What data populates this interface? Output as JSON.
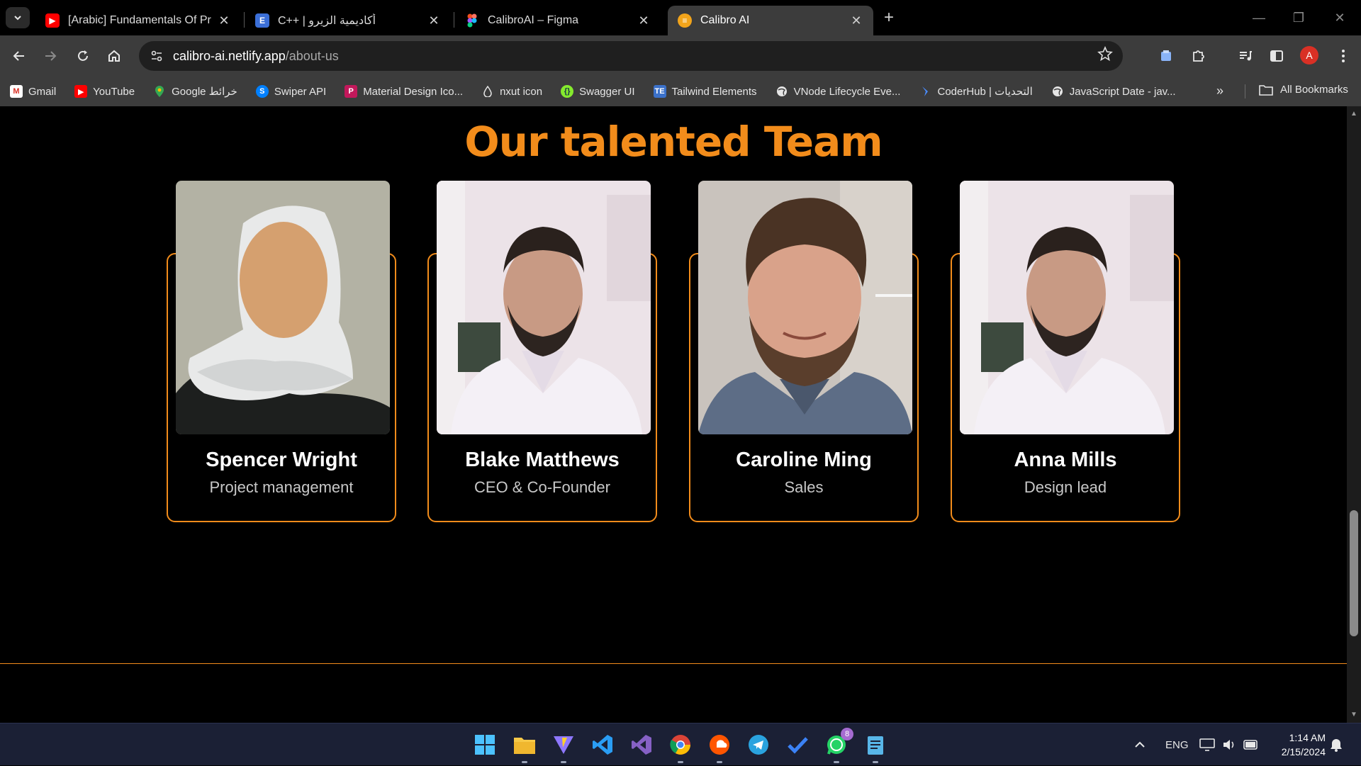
{
  "browser": {
    "tabs": [
      {
        "title": "[Arabic] Fundamentals Of Progr",
        "favicon": "youtube-icon",
        "active": false
      },
      {
        "title": "C++ | أكاديمية الزيرو",
        "favicon": "e-letter-icon",
        "active": false
      },
      {
        "title": "CalibroAI – Figma",
        "favicon": "figma-icon",
        "active": false
      },
      {
        "title": "Calibro AI",
        "favicon": "calibro-icon",
        "active": true
      }
    ],
    "url": {
      "host": "calibro-ai.netlify.app",
      "path": "/about-us"
    },
    "profile_initial": "A",
    "bookmarks": [
      {
        "label": "Gmail",
        "icon": "gmail-icon"
      },
      {
        "label": "YouTube",
        "icon": "youtube-icon"
      },
      {
        "label": "Google خرائط",
        "icon": "maps-pin-icon"
      },
      {
        "label": "Swiper API",
        "icon": "swiper-icon"
      },
      {
        "label": "Material Design Ico...",
        "icon": "material-design-icon"
      },
      {
        "label": "nxut icon",
        "icon": "drop-icon"
      },
      {
        "label": "Swagger UI",
        "icon": "swagger-icon"
      },
      {
        "label": "Tailwind Elements",
        "icon": "tailwind-elements-icon"
      },
      {
        "label": "VNode Lifecycle Eve...",
        "icon": "globe-icon"
      },
      {
        "label": "CoderHub | التحديات",
        "icon": "coderhub-icon"
      },
      {
        "label": "JavaScript Date - jav...",
        "icon": "globe-icon"
      }
    ],
    "all_bookmarks_label": "All Bookmarks"
  },
  "page": {
    "title": "Our talented Team",
    "team": [
      {
        "name": "Spencer Wright",
        "role": "Project management",
        "photo": "hijab-avatar-illustration"
      },
      {
        "name": "Blake Matthews",
        "role": "CEO & Co-Founder",
        "photo": "portrait-bearded-man-white-shirt"
      },
      {
        "name": "Caroline Ming",
        "role": "Sales",
        "photo": "portrait-curly-hair-man-smiling"
      },
      {
        "name": "Anna Mills",
        "role": "Design lead",
        "photo": "portrait-bearded-man-white-shirt"
      }
    ]
  },
  "taskbar": {
    "apps": [
      "windows-start-icon",
      "file-explorer-icon",
      "vite-icon",
      "vscode-icon",
      "visual-studio-icon",
      "chrome-icon",
      "soundcloud-icon",
      "telegram-icon",
      "todo-icon",
      "whatsapp-icon",
      "notepad-icon"
    ],
    "whatsapp_badge": "8",
    "language": "ENG",
    "time": "1:14 AM",
    "date": "2/15/2024"
  },
  "colors": {
    "accent": "#f28c1b",
    "page_bg": "#000000",
    "chrome_bg": "#3c3c3c",
    "taskbar_bg": "#1b2035"
  }
}
